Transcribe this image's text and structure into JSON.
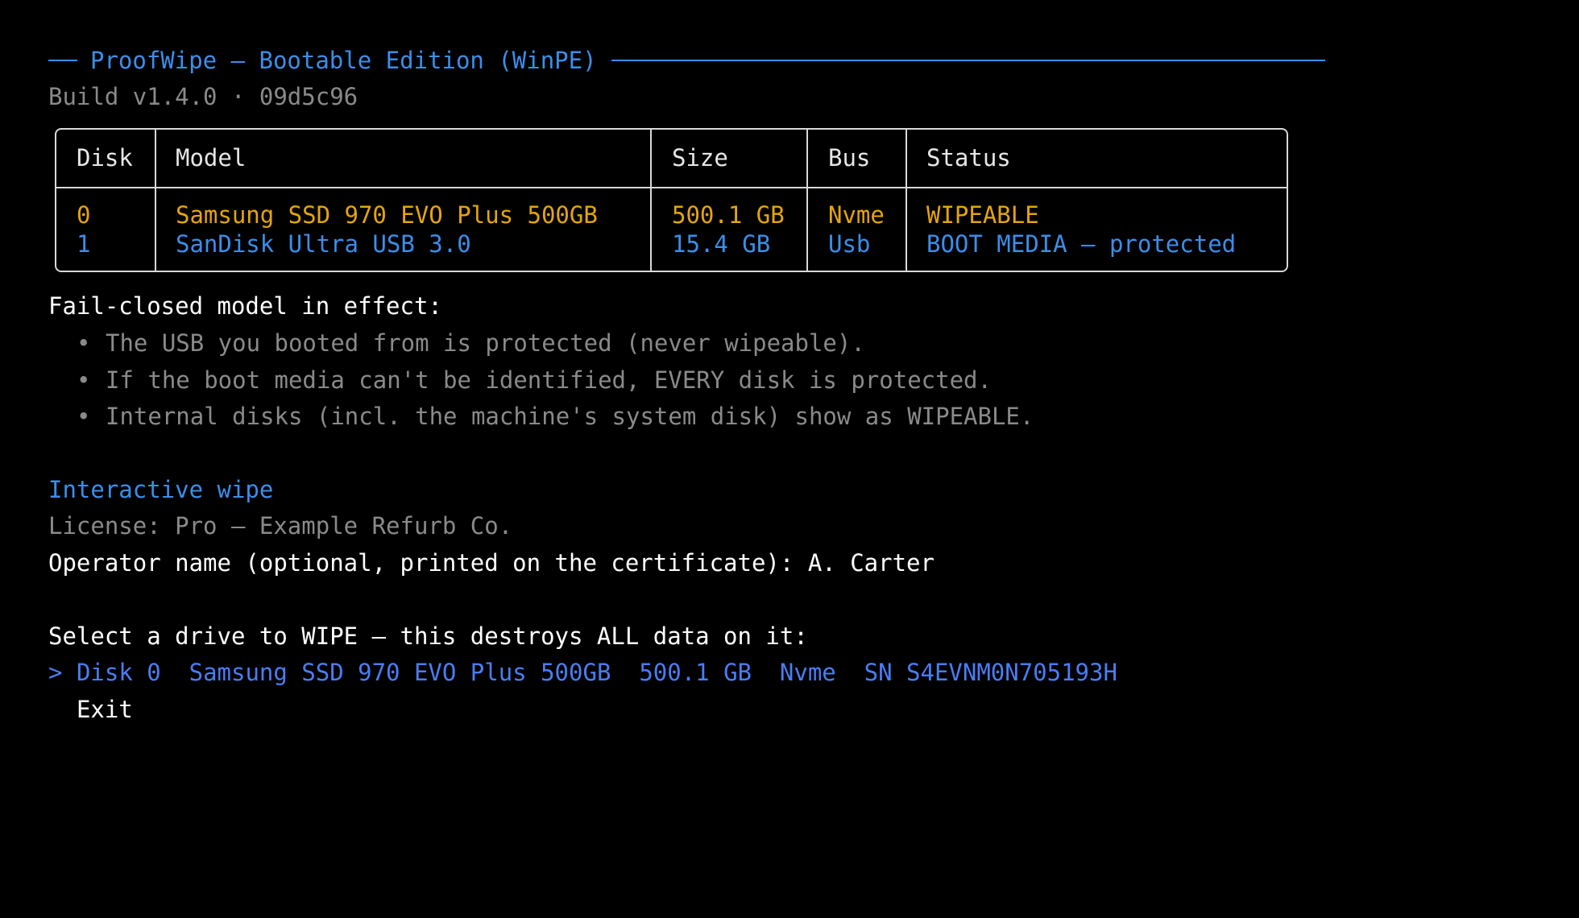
{
  "header": {
    "title": "ProofWipe — Bootable Edition (WinPE)",
    "build": "Build v1.4.0 · 09d5c96"
  },
  "table": {
    "columns": [
      "Disk",
      "Model",
      "Size",
      "Bus",
      "Status"
    ],
    "rows": [
      {
        "disk": "0",
        "model": "Samsung SSD 970 EVO Plus 500GB",
        "size": "500.1 GB",
        "bus": "Nvme",
        "status": "WIPEABLE"
      },
      {
        "disk": "1",
        "model": "SanDisk Ultra USB 3.0",
        "size": "15.4 GB",
        "bus": "Usb",
        "status": "BOOT MEDIA — protected"
      }
    ]
  },
  "notes": {
    "heading": "Fail-closed model in effect:",
    "items": [
      "The USB you booted from is protected (never wipeable).",
      "If the boot media can't be identified, EVERY disk is protected.",
      "Internal disks (incl. the machine's system disk) show as WIPEABLE."
    ]
  },
  "wipe": {
    "section_title": "Interactive wipe",
    "license": "License: Pro — Example Refurb Co.",
    "operator_prompt": "Operator name (optional, printed on the certificate):",
    "operator_value": "A. Carter",
    "select_prompt": "Select a drive to WIPE — this destroys ALL data on it:",
    "options": [
      {
        "cursor": ">",
        "label": "Disk 0  Samsung SSD 970 EVO Plus 500GB  500.1 GB  Nvme  SN S4EVNM0N705193H",
        "selected": true
      },
      {
        "cursor": " ",
        "label": "Exit",
        "selected": false
      }
    ]
  },
  "colors": {
    "background": "#000000",
    "accent_blue": "#3b8eea",
    "wipeable_amber": "#e5a50a",
    "muted_gray": "#8a8a8a",
    "selected_option": "#4a7df5"
  }
}
